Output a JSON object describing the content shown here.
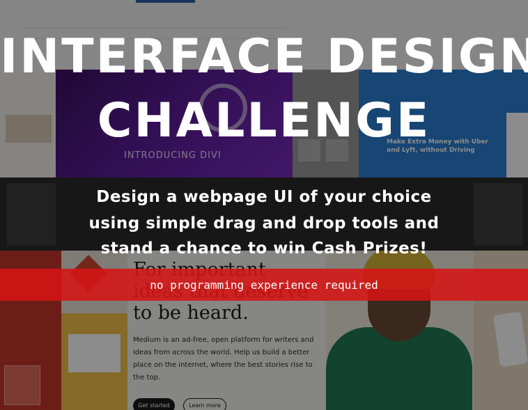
{
  "banner": {
    "title_line_1": "INTERFACE DESIGN",
    "title_line_2": "CHALLENGE",
    "subtitle_line_1": "Design a webpage UI of your choice",
    "subtitle_line_2": "using simple drag and drop tools and",
    "subtitle_line_3": "stand a chance to win Cash Prizes!",
    "band_text": "no programming experience required"
  },
  "background_collage": {
    "divi_headline": "INTRODUCING DIVI",
    "blue_card_title": "Make Extra Money with Uber and Lyft, without Driving",
    "medium": {
      "hero": "For important ideas that deserve to be heard.",
      "paragraph": "Medium is an ad-free, open platform for writers and ideas from across the world. Help us build a better place on the internet, where the best stories rise to the top.",
      "primary_button": "Get started",
      "secondary_button": "Learn more"
    }
  },
  "colors": {
    "band_red": "#d61414",
    "title_white": "#ffffff",
    "overlay": "rgba(0,0,0,0.45)"
  }
}
